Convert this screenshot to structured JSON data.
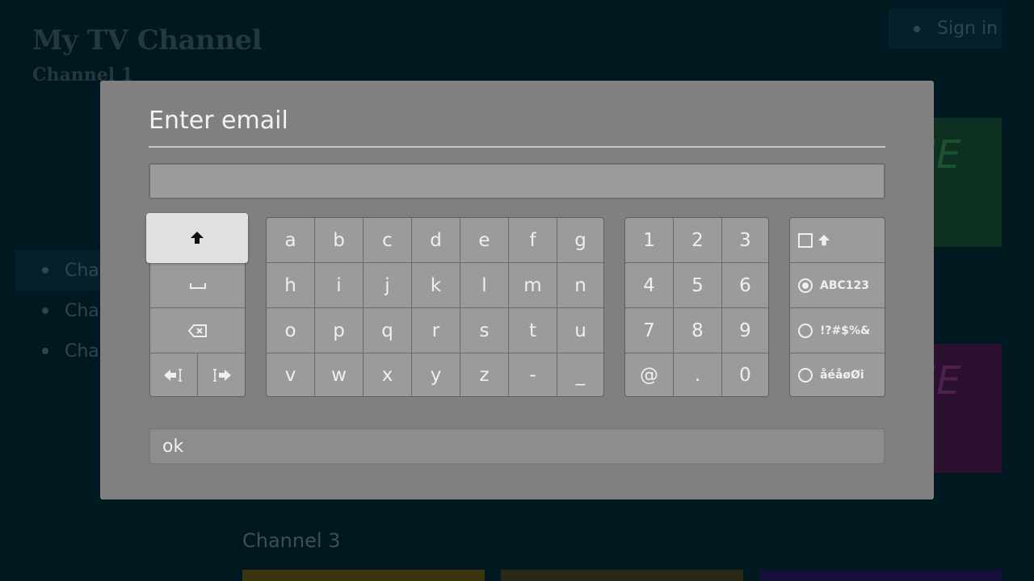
{
  "app": {
    "title": "My TV Channel",
    "subtitle": "Channel 1",
    "sign_in": "Sign in",
    "nav_items": [
      "Cha",
      "Cha",
      "Cha"
    ],
    "tile_text": "IE",
    "row_label": "Channel 3"
  },
  "dialog": {
    "title": "Enter email",
    "input_value": "",
    "ok_label": "ok"
  },
  "keyboard": {
    "letters": [
      [
        "a",
        "b",
        "c",
        "d",
        "e",
        "f",
        "g"
      ],
      [
        "h",
        "i",
        "j",
        "k",
        "l",
        "m",
        "n"
      ],
      [
        "o",
        "p",
        "q",
        "r",
        "s",
        "t",
        "u"
      ],
      [
        "v",
        "w",
        "x",
        "y",
        "z",
        "-",
        "_"
      ]
    ],
    "numbers": [
      [
        "1",
        "2",
        "3"
      ],
      [
        "4",
        "5",
        "6"
      ],
      [
        "7",
        "8",
        "9"
      ],
      [
        "@",
        ".",
        "0"
      ]
    ],
    "modes": [
      {
        "label": "ABC123",
        "selected": true
      },
      {
        "label": "!?#$%&",
        "selected": false
      },
      {
        "label": "åéåøØi",
        "selected": false
      }
    ],
    "icons": {
      "shift": "shift-arrow-icon",
      "space": "space-icon",
      "backspace": "backspace-icon",
      "cursor_left": "cursor-left-icon",
      "cursor_right": "cursor-right-icon",
      "caps_lock": "caps-lock-icon"
    }
  },
  "colors": {
    "background": "#001820",
    "dialog": "#808080",
    "key": "#9b9b9b",
    "focus_key": "#e0e0e0",
    "text": "#efefef"
  }
}
